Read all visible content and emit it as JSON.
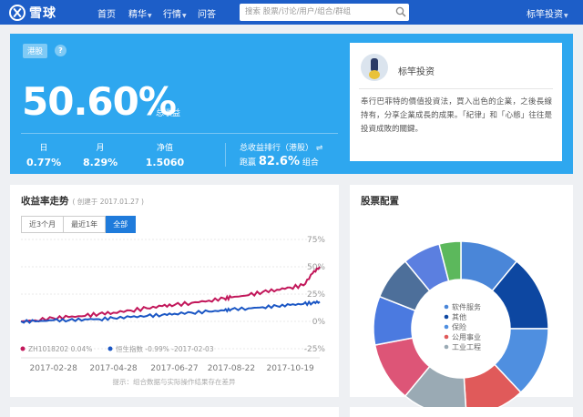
{
  "nav": {
    "logo_text": "雪球",
    "items": [
      {
        "label": "首页",
        "dropdown": false
      },
      {
        "label": "精华",
        "dropdown": true
      },
      {
        "label": "行情",
        "dropdown": true
      },
      {
        "label": "问答",
        "dropdown": false
      }
    ],
    "search_placeholder": "搜索 股票/讨论/用户/组合/群组",
    "user_label": "标竿投资"
  },
  "hero": {
    "market_badge": "港股",
    "help_icon": "?",
    "total_return": "50.60%",
    "total_return_label": "总收益",
    "stats": [
      {
        "label": "日",
        "value": "0.77%"
      },
      {
        "label": "月",
        "value": "8.29%"
      },
      {
        "label": "净值",
        "value": "1.5060"
      }
    ],
    "rank_title": "总收益排行（港股）",
    "rank_prefix": "跑赢",
    "rank_value": "82.6%",
    "rank_suffix": "组合",
    "background_color": "#2ea7ef"
  },
  "profile": {
    "name": "标竿投资",
    "description": "奉行巴菲特的價值投資法，買入出色的企業，之後長線持有，分享企業成長的成果。「紀律」和「心態」往往是投資成敗的關鍵。"
  },
  "returns_card": {
    "title": "收益率走势",
    "created": "( 创建于 2017.01.27 )",
    "tabs": [
      {
        "label": "近3个月",
        "active": false
      },
      {
        "label": "最近1年",
        "active": false
      },
      {
        "label": "全部",
        "active": true
      }
    ],
    "note": "提示：组合数据与实际操作结果存在差异"
  },
  "chart_data": {
    "type": "line",
    "y_ticks": [
      "75%",
      "50%",
      "25%",
      "0%",
      "-25%"
    ],
    "ylim": [
      -25,
      75
    ],
    "x_ticks": [
      "2017-02-28",
      "2017-04-28",
      "2017-06-27",
      "2017-08-22",
      "2017-10-19"
    ],
    "xlim": [
      "2017-01-27",
      "2017-11-17"
    ],
    "grid": true,
    "legend_position": "bottom-left",
    "series": [
      {
        "name": "ZH1018202",
        "legend_text": "ZH1018202 0.04%",
        "color": "#c2185b",
        "points": [
          [
            "2017-01-27",
            0
          ],
          [
            "2017-02-10",
            1
          ],
          [
            "2017-02-28",
            3
          ],
          [
            "2017-03-15",
            4
          ],
          [
            "2017-03-31",
            5
          ],
          [
            "2017-04-14",
            7
          ],
          [
            "2017-04-28",
            8
          ],
          [
            "2017-05-15",
            10
          ],
          [
            "2017-05-31",
            12
          ],
          [
            "2017-06-15",
            14
          ],
          [
            "2017-06-27",
            15
          ],
          [
            "2017-07-14",
            17
          ],
          [
            "2017-07-31",
            19
          ],
          [
            "2017-08-15",
            21
          ],
          [
            "2017-08-22",
            22
          ],
          [
            "2017-09-08",
            24
          ],
          [
            "2017-09-22",
            27
          ],
          [
            "2017-10-06",
            29
          ],
          [
            "2017-10-19",
            31
          ],
          [
            "2017-11-01",
            33
          ],
          [
            "2017-11-10",
            44
          ],
          [
            "2017-11-17",
            50
          ]
        ]
      },
      {
        "name": "恒生指数",
        "legend_text": "恒生指数 -0.99% -2017-02-03",
        "color": "#1a56c4",
        "points": [
          [
            "2017-01-27",
            0
          ],
          [
            "2017-02-10",
            0
          ],
          [
            "2017-02-28",
            1
          ],
          [
            "2017-03-15",
            1
          ],
          [
            "2017-03-31",
            2
          ],
          [
            "2017-04-14",
            2
          ],
          [
            "2017-04-28",
            3
          ],
          [
            "2017-05-15",
            4
          ],
          [
            "2017-05-31",
            5
          ],
          [
            "2017-06-15",
            6
          ],
          [
            "2017-06-27",
            7
          ],
          [
            "2017-07-14",
            8
          ],
          [
            "2017-07-31",
            9
          ],
          [
            "2017-08-15",
            10
          ],
          [
            "2017-08-22",
            11
          ],
          [
            "2017-09-08",
            12
          ],
          [
            "2017-09-22",
            13
          ],
          [
            "2017-10-06",
            14
          ],
          [
            "2017-10-19",
            15
          ],
          [
            "2017-11-01",
            16
          ],
          [
            "2017-11-10",
            17
          ],
          [
            "2017-11-17",
            18
          ]
        ]
      }
    ]
  },
  "allocation_card": {
    "title": "股票配置",
    "legend": [
      {
        "label": "软件服务",
        "color": "#4a86d8"
      },
      {
        "label": "其他",
        "color": "#0d47a1"
      },
      {
        "label": "保险",
        "color": "#4f8fe0"
      },
      {
        "label": "公用事业",
        "color": "#e05a5a"
      },
      {
        "label": "工业工程",
        "color": "#9aaab4"
      }
    ],
    "donut_data": {
      "type": "pie",
      "slices": [
        {
          "label": "软件服务",
          "value": 11,
          "color": "#4a86d8"
        },
        {
          "label": "其他",
          "value": 14,
          "color": "#0d47a1"
        },
        {
          "label": "保险",
          "value": 13,
          "color": "#4f8fe0"
        },
        {
          "label": "公用事业",
          "value": 11,
          "color": "#e05a5a"
        },
        {
          "label": "工业工程",
          "value": 12,
          "color": "#9aaab4"
        },
        {
          "label": "",
          "value": 11,
          "color": "#dd5577"
        },
        {
          "label": "",
          "value": 9,
          "color": "#4b7ae0"
        },
        {
          "label": "",
          "value": 8,
          "color": "#4d6f9a"
        },
        {
          "label": "",
          "value": 7,
          "color": "#5b7fe0"
        },
        {
          "label": "",
          "value": 4,
          "color": "#5cb85c"
        }
      ]
    }
  }
}
